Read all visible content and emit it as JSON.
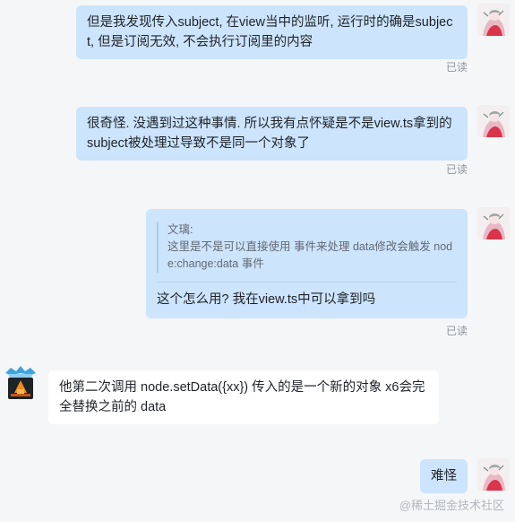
{
  "messages": [
    {
      "text": "但是我发现传入subject, 在view当中的监听, 运行时的确是subject, 但是订阅无效, 不会执行订阅里的内容",
      "status": "已读"
    },
    {
      "text": "很奇怪. 没遇到过这种事情. 所以我有点怀疑是不是view.ts拿到的subject被处理过导致不是同一个对象了",
      "status": "已读"
    },
    {
      "quote_author": "文璃:",
      "quote_text": "这里是不是可以直接使用 事件来处理 data修改会触发 node:change:data 事件",
      "text": "这个怎么用? 我在view.ts中可以拿到吗",
      "status": "已读"
    },
    {
      "text": "他第二次调用 node.setData({xx}) 传入的是一个新的对象 x6会完全替换之前的 data"
    },
    {
      "text": "难怪"
    }
  ],
  "watermark": "@稀土掘金技术社区",
  "colors": {
    "outgoing_bubble": "#cce4fc",
    "incoming_bubble": "#ffffff",
    "background": "#f5f6f7",
    "read_status": "#8f959e"
  }
}
